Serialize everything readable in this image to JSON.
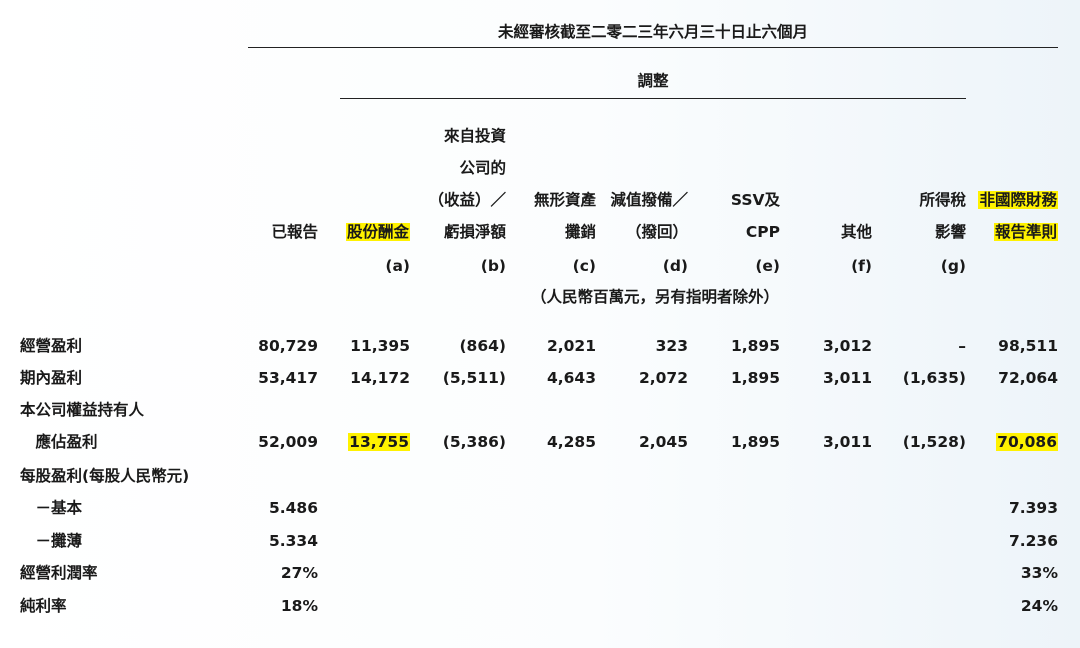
{
  "title": "未經審核截至二零二三年六月三十日止六個月",
  "adjust_label": "調整",
  "unit_note": "（人民幣百萬元，另有指明者除外）",
  "columns": [
    {
      "lines": [
        "已報告"
      ],
      "tag": ""
    },
    {
      "lines": [
        "股份酬金"
      ],
      "tag": "(a)",
      "highlight": true
    },
    {
      "lines": [
        "來自投資",
        "公司的",
        "（收益）／",
        "虧損淨額"
      ],
      "tag": "(b)"
    },
    {
      "lines": [
        "無形資產",
        "攤銷"
      ],
      "tag": "(c)"
    },
    {
      "lines": [
        "減值撥備／",
        "（撥回）"
      ],
      "tag": "(d)"
    },
    {
      "lines": [
        "SSV及",
        "CPP"
      ],
      "tag": "(e)"
    },
    {
      "lines": [
        "其他"
      ],
      "tag": "(f)"
    },
    {
      "lines": [
        "所得稅",
        "影響"
      ],
      "tag": "(g)"
    },
    {
      "lines": [
        "非國際財務",
        "報告準則"
      ],
      "tag": "",
      "highlight": true
    }
  ],
  "rows": [
    {
      "label": "經營盈利",
      "values": [
        "80,729",
        "11,395",
        "(864)",
        "2,021",
        "323",
        "1,895",
        "3,012",
        "–",
        "98,511"
      ]
    },
    {
      "label": "期內盈利",
      "values": [
        "53,417",
        "14,172",
        "(5,511)",
        "4,643",
        "2,072",
        "1,895",
        "3,011",
        "(1,635)",
        "72,064"
      ]
    },
    {
      "label": "本公司權益持有人",
      "values": [
        "",
        "",
        "",
        "",
        "",
        "",
        "",
        "",
        ""
      ]
    },
    {
      "label": "　應佔盈利",
      "values": [
        "52,009",
        "13,755",
        "(5,386)",
        "4,285",
        "2,045",
        "1,895",
        "3,011",
        "(1,528)",
        "70,086"
      ],
      "highlight_cols": [
        1,
        8
      ]
    },
    {
      "label": "每股盈利(每股人民幣元)",
      "values": [
        "",
        "",
        "",
        "",
        "",
        "",
        "",
        "",
        ""
      ]
    },
    {
      "label": "　－基本",
      "values": [
        "5.486",
        "",
        "",
        "",
        "",
        "",
        "",
        "",
        "7.393"
      ]
    },
    {
      "label": "　－攤薄",
      "values": [
        "5.334",
        "",
        "",
        "",
        "",
        "",
        "",
        "",
        "7.236"
      ]
    },
    {
      "label": "經營利潤率",
      "values": [
        "27%",
        "",
        "",
        "",
        "",
        "",
        "",
        "",
        "33%"
      ]
    },
    {
      "label": "純利率",
      "values": [
        "18%",
        "",
        "",
        "",
        "",
        "",
        "",
        "",
        "24%"
      ]
    }
  ]
}
